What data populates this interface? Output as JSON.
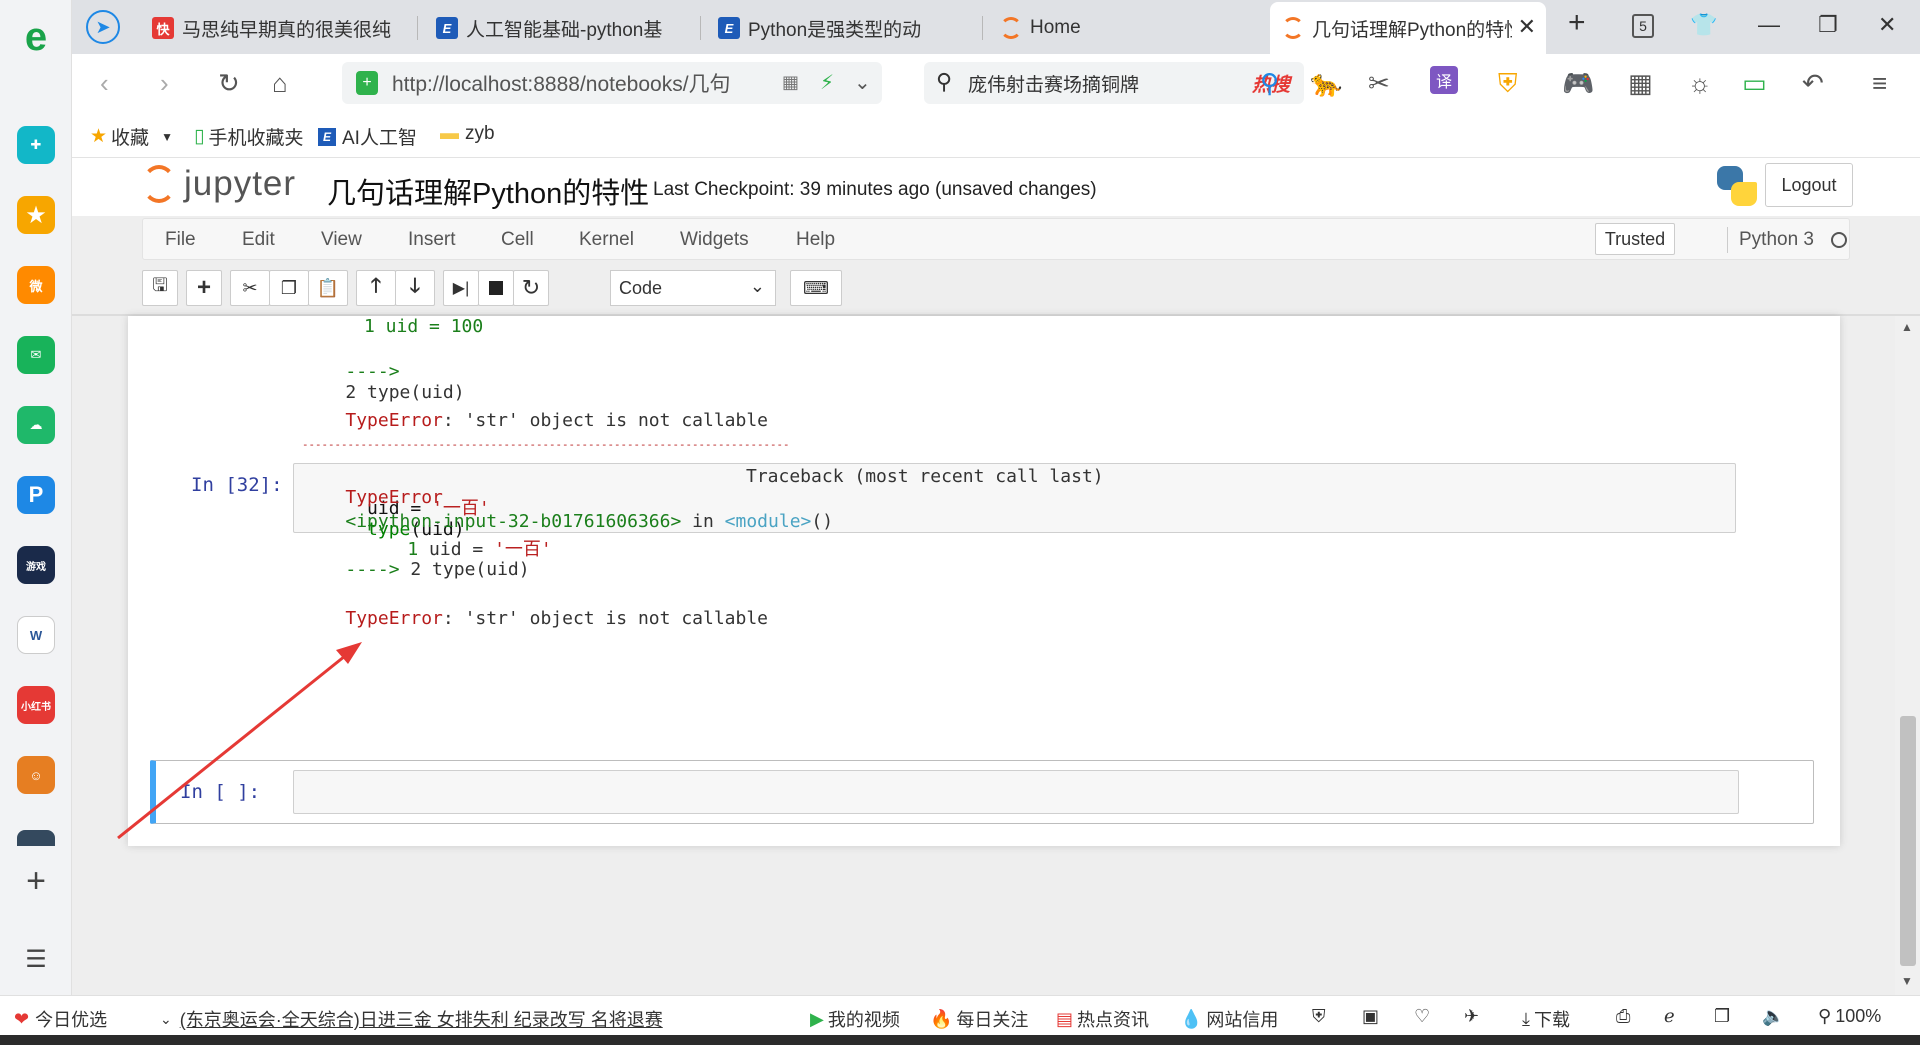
{
  "browser": {
    "tabs": [
      {
        "label": "马思纯早期真的很美很纯",
        "fav_color": "#e53935",
        "fav_text": "快"
      },
      {
        "label": "人工智能基础-python基",
        "fav_color": "#1e5bb8",
        "fav_text": "E"
      },
      {
        "label": "Python是强类型的动",
        "fav_color": "#1e5bb8",
        "fav_text": "E"
      },
      {
        "label": "Home",
        "fav_color": "#f37626",
        "fav_text": ""
      },
      {
        "label": "几句话理解Python的特性",
        "fav_color": "#f37626",
        "fav_text": ""
      }
    ],
    "tab_count": "5",
    "url": "http://localhost:8888/notebooks/几句",
    "search_text": "庞伟射击赛场摘铜牌",
    "search_hot": "热搜",
    "bookmarks": [
      "收藏",
      "手机收藏夹",
      "AI人工智",
      "zyb"
    ],
    "accent": "#f37626"
  },
  "jupyter": {
    "logo_text": "jupyter",
    "notebook_name": "几句话理解Python的特性",
    "checkpoint": "Last Checkpoint: 39 minutes ago (unsaved changes)",
    "logout_label": "Logout",
    "menus": [
      "File",
      "Edit",
      "View",
      "Insert",
      "Cell",
      "Kernel",
      "Widgets",
      "Help"
    ],
    "trusted_label": "Trusted",
    "kernel_name": "Python 3",
    "cell_type": "Code"
  },
  "cells": {
    "prev_output": {
      "line1": "1 uid = 100",
      "line2_arrow": "---->",
      "line2_code": "2 type(uid)",
      "error_name": "TypeError",
      "error_msg": ": 'str' object is not callable"
    },
    "cell32": {
      "prompt": "In  [32]:",
      "code1_var": "uid = ",
      "code1_str": "'一百'",
      "code2_fn": "type",
      "code2_rest": "(uid)"
    },
    "output32": {
      "dashes": "---------------------------------------------------------------------------",
      "err_type": "TypeError",
      "traceback": "Traceback (most recent call last)",
      "input_name": "<ipython-input-32-b01761606366>",
      "in_text": " in ",
      "module": "<module>",
      "parens": "()",
      "l1_no": "1 ",
      "l1_code": "uid = ",
      "l1_str": "'一百'",
      "l2_arrow": "---->",
      "l2_code": " 2 type(uid)",
      "error_name": "TypeError",
      "error_msg": ": 'str' object is not callable"
    },
    "new_cell_prompt": "In  [  ]:"
  },
  "statusbar": {
    "left_label": "今日优选",
    "headline": "(东京奥运会·全天综合)日进三金 女排失利 纪录改写 名将退赛",
    "items": [
      "我的视频",
      "每日关注",
      "热点资讯",
      "网站信用",
      "下载"
    ],
    "zoom": "100%"
  }
}
